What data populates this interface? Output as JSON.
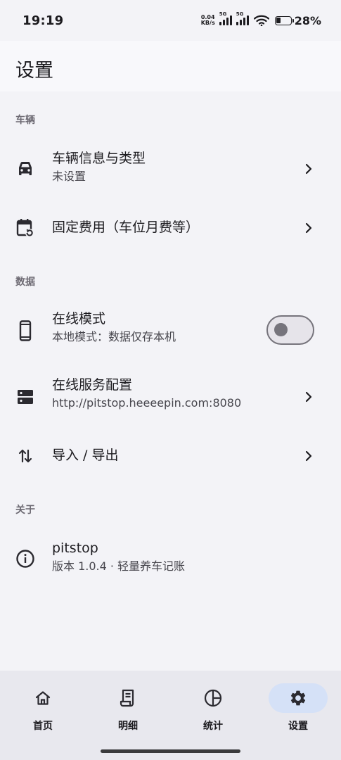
{
  "status_bar": {
    "time": "19:19",
    "net_speed_value": "0.04",
    "net_speed_unit": "KB/s",
    "sim1_tag": "5G",
    "sim2_tag": "5G",
    "battery_percent": "28%"
  },
  "header": {
    "title": "设置"
  },
  "sections": {
    "vehicle": {
      "label": "车辆",
      "vehicle_info": {
        "title": "车辆信息与类型",
        "subtitle": "未设置",
        "icon": "car-icon"
      },
      "fixed_costs": {
        "title": "固定费用（车位月费等）",
        "icon": "calendar-refresh-icon"
      }
    },
    "data": {
      "label": "数据",
      "online_mode": {
        "title": "在线模式",
        "subtitle": "本地模式：数据仅存本机",
        "icon": "phone-icon",
        "enabled": false
      },
      "service_config": {
        "title": "在线服务配置",
        "subtitle": "http://pitstop.heeeepin.com:8080",
        "icon": "server-icon"
      },
      "import_export": {
        "title": "导入 / 导出",
        "icon": "swap-vertical-icon"
      }
    },
    "about": {
      "label": "关于",
      "app_info": {
        "title": "pitstop",
        "subtitle": "版本 1.0.4 · 轻量养车记账",
        "icon": "info-icon"
      }
    }
  },
  "bottom_nav": {
    "items": [
      {
        "label": "首页",
        "icon": "home-icon",
        "active": false
      },
      {
        "label": "明细",
        "icon": "receipt-icon",
        "active": false
      },
      {
        "label": "统计",
        "icon": "pie-chart-icon",
        "active": false
      },
      {
        "label": "设置",
        "icon": "gear-icon",
        "active": true
      }
    ]
  },
  "colors": {
    "background": "#f3f3f7",
    "header_bg": "#f8f8fb",
    "nav_bg": "#e8e8ee",
    "active_pill": "#d5e1f7",
    "secondary_text": "#6d6a73"
  }
}
